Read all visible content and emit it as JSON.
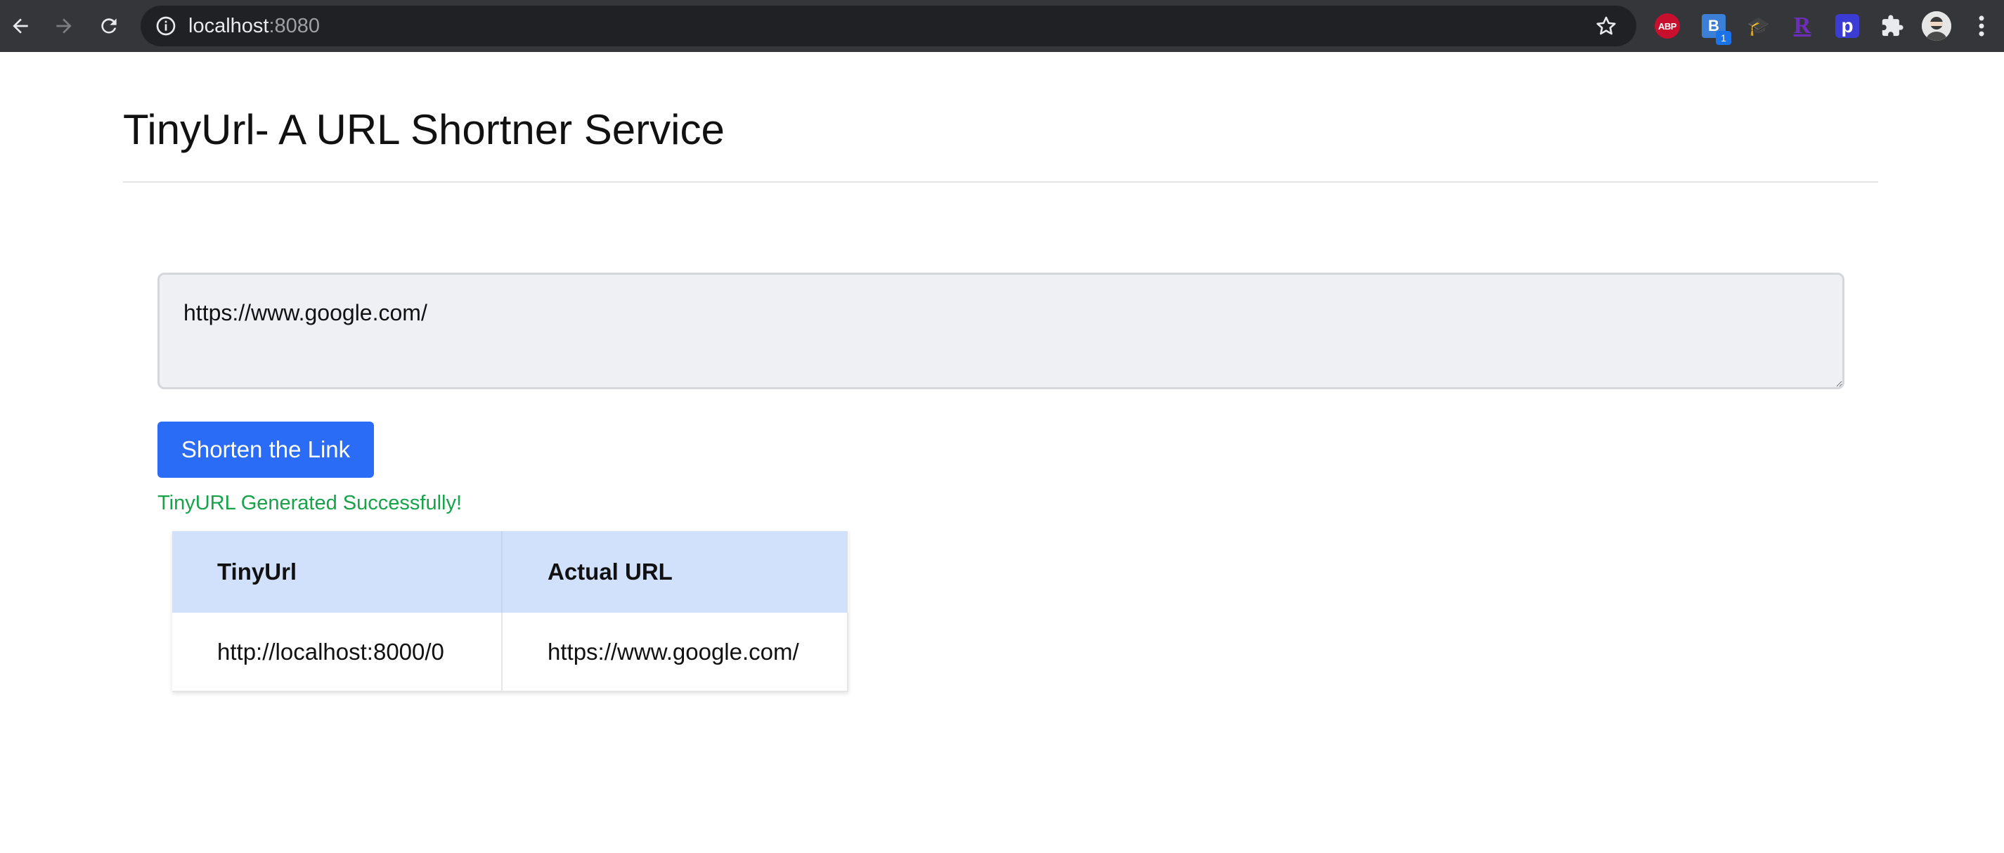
{
  "browser": {
    "url_host": "localhost",
    "url_port": ":8080",
    "extensions": [
      {
        "name": "adblock-plus-icon",
        "text": "ABP"
      },
      {
        "name": "bookmark-b-icon",
        "text": "B",
        "badge": "1"
      },
      {
        "name": "graduation-cap-icon",
        "text": "🎓"
      },
      {
        "name": "r-extension-icon",
        "text": "R"
      },
      {
        "name": "p-extension-icon",
        "text": "p"
      }
    ]
  },
  "page": {
    "title": "TinyUrl- A URL Shortner Service",
    "input_value": "https://www.google.com/",
    "shorten_button_label": "Shorten the Link",
    "success_message": "TinyURL Generated Successfully!"
  },
  "table": {
    "headers": [
      "TinyUrl",
      "Actual URL"
    ],
    "rows": [
      [
        "http://localhost:8000/0",
        "https://www.google.com/"
      ]
    ]
  },
  "colors": {
    "accent_button": "#2b6cf6",
    "success_text": "#16a34a",
    "table_header_bg": "#d1e1fb",
    "chrome_bg": "#35363a"
  }
}
